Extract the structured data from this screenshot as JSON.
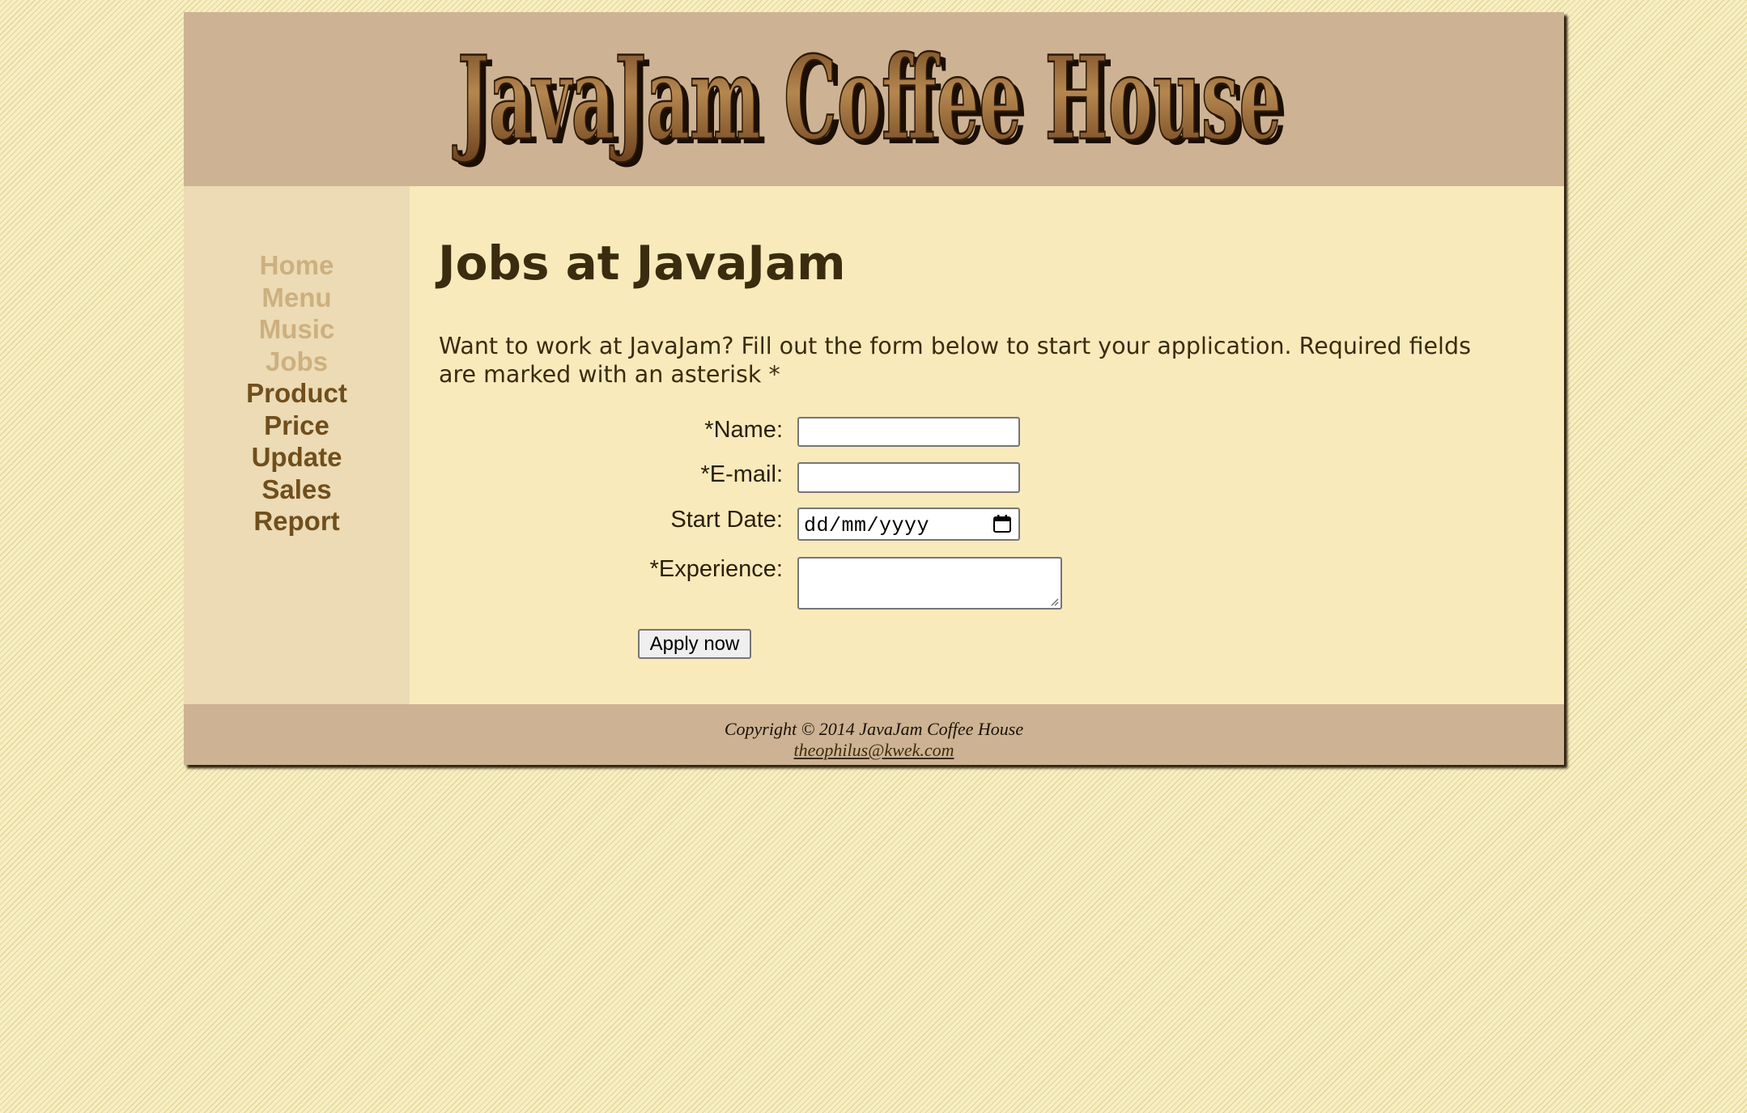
{
  "header": {
    "logo_text": "JavaJam Coffee House"
  },
  "nav": {
    "items": [
      {
        "label": "Home",
        "visited": true
      },
      {
        "label": "Menu",
        "visited": true
      },
      {
        "label": "Music",
        "visited": true
      },
      {
        "label": "Jobs",
        "visited": true
      },
      {
        "label": "Product",
        "visited": false
      },
      {
        "label": "Price",
        "visited": false
      },
      {
        "label": "Update",
        "visited": false
      },
      {
        "label": "Sales",
        "visited": false
      },
      {
        "label": "Report",
        "visited": false
      }
    ]
  },
  "main": {
    "title": "Jobs at JavaJam",
    "intro": "Want to work at JavaJam? Fill out the form below to start your application. Required fields are marked with an asterisk *",
    "form": {
      "name_label": "*Name:",
      "name_value": "",
      "email_label": "*E-mail:",
      "email_value": "",
      "start_date_label": "Start Date:",
      "start_date_placeholder": "dd/mm/yyyy",
      "experience_label": "*Experience:",
      "experience_value": "",
      "submit_label": "Apply now"
    }
  },
  "footer": {
    "copyright": "Copyright © 2014 JavaJam Coffee House",
    "email": "theophilus@kwek.com"
  },
  "colors": {
    "header_bg": "#cdb393",
    "nav_bg": "#ecdbb4",
    "content_bg": "#f9eabb",
    "nav_link": "#704f1d",
    "nav_link_visited": "#cdb07f",
    "heading": "#3a2c0e"
  }
}
